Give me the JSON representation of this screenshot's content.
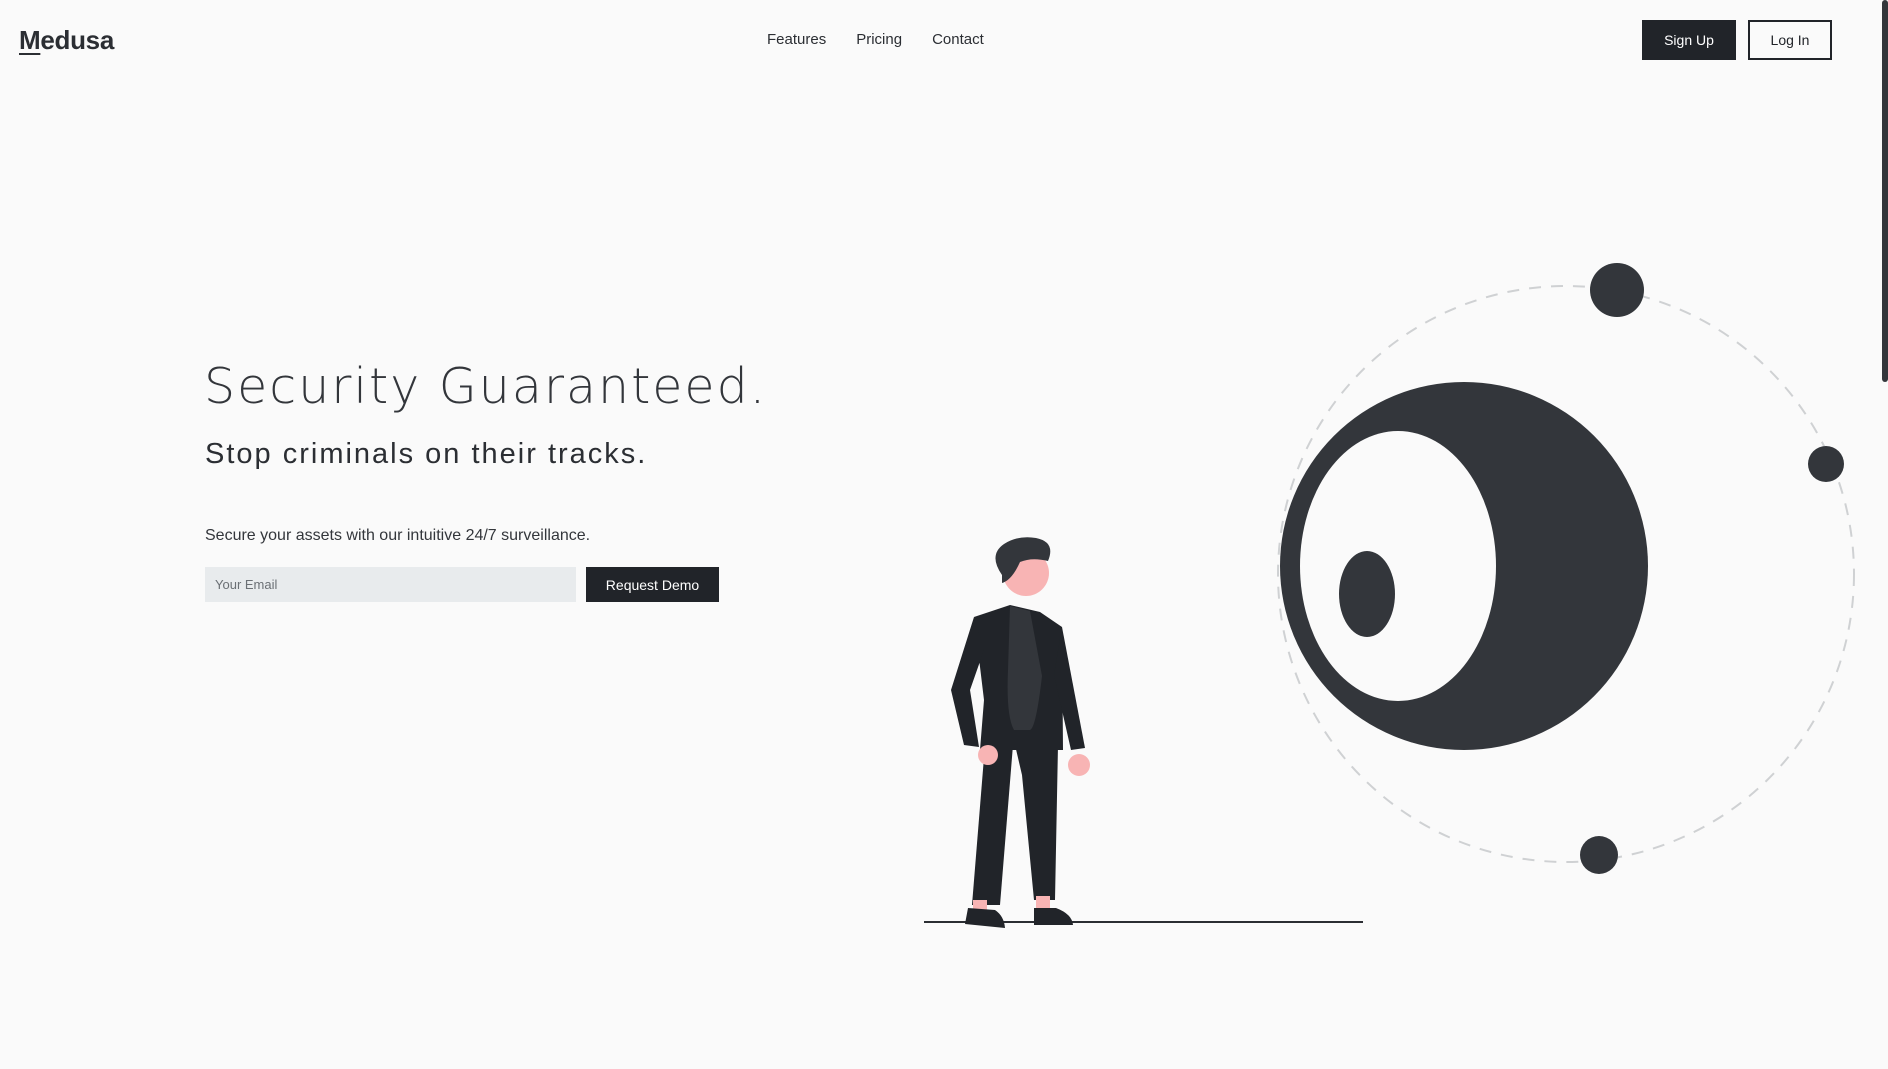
{
  "brand": {
    "name_first_letter": "M",
    "name_rest": "edusa"
  },
  "nav": {
    "items": [
      {
        "label": "Features"
      },
      {
        "label": "Pricing"
      },
      {
        "label": "Contact"
      }
    ]
  },
  "auth": {
    "signup_label": "Sign Up",
    "login_label": "Log In"
  },
  "hero": {
    "title": "Security Guaranteed.",
    "subtitle": "Stop criminals on their tracks.",
    "description": "Secure your assets with our intuitive 24/7 surveillance.",
    "email_placeholder": "Your Email",
    "email_value": "",
    "cta_label": "Request Demo"
  },
  "colors": {
    "background": "#fafafa",
    "primary_dark": "#212429",
    "eye_dark": "#33363b",
    "skin": "#f8b4b4",
    "input_bg": "#e8ebed"
  },
  "icons": {
    "illustration": "person-watching-eye-illustration"
  }
}
